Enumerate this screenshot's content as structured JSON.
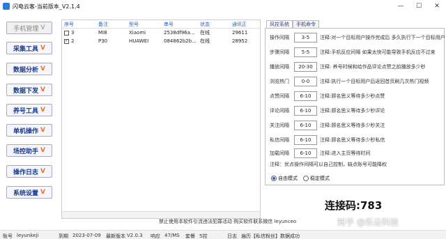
{
  "window": {
    "title": "闪电云客-当前版本_V2.1.4"
  },
  "sidebar": {
    "items": [
      {
        "label": "手机管理",
        "chevron": "V"
      },
      {
        "label": "采集工具",
        "chevron": "V"
      },
      {
        "label": "数据分析",
        "chevron": "V"
      },
      {
        "label": "数据下发",
        "chevron": "V"
      },
      {
        "label": "养号工具",
        "chevron": "V"
      },
      {
        "label": "单机操作",
        "chevron": "V"
      },
      {
        "label": "场控助手",
        "chevron": "V"
      },
      {
        "label": "操作日志",
        "chevron": "V"
      },
      {
        "label": "系统设置",
        "chevron": "V"
      }
    ]
  },
  "table": {
    "headers": [
      "序号",
      "备注",
      "型号",
      "串号",
      "状态",
      "通讯正"
    ],
    "rows": [
      {
        "checked": false,
        "index": "3",
        "remark": "MI8",
        "model": "Xiaomi",
        "serial": "2538df96a...",
        "status": "在线",
        "port": "29611"
      },
      {
        "checked": true,
        "index": "2",
        "remark": "P30",
        "model": "HUAWEI",
        "serial": "084862b2b...",
        "status": "在线",
        "port": "28952"
      }
    ]
  },
  "tabs": [
    "风控系统",
    "手机命令"
  ],
  "settings": {
    "rows": [
      {
        "label": "操作间隔",
        "value": "3-5",
        "note": "注释:对一个目标用户操作完成后 多久执行下一个目标用户"
      },
      {
        "label": "步骤间隔",
        "value": "5-5",
        "note": "注释:手机反应间隔 如果太快可能导致手机反应不过来"
      },
      {
        "label": "播放间隔",
        "value": "20-30",
        "note": "注释: 养号时候和给作品评论点赞之前播放多少秒"
      },
      {
        "label": "浏览热门",
        "value": "0-0",
        "note": "注释:执行一个目标用户后返回首页刷几次热门视频"
      },
      {
        "label": "点赞间隔",
        "value": "6-10",
        "note": "注释:顾名思义等待多少秒点赞"
      },
      {
        "label": "评论间隔",
        "value": "6-10",
        "note": "注释:顾名思义等待多少秒评论"
      },
      {
        "label": "关注间隔",
        "value": "6-10",
        "note": "注释:顾名思义等待多少秒关注"
      },
      {
        "label": "私信间隔",
        "value": "6-10",
        "note": "注释:顾名思义等待多少秒私信"
      },
      {
        "label": "加载间隔",
        "value": "6-10",
        "note": "注释:进入主页等待时间"
      }
    ],
    "warning": "注释：优点操作间隔可以自己控制，缺点账号可能降权",
    "modes": [
      {
        "label": "自由模式",
        "selected": true
      },
      {
        "label": "稳定模式",
        "selected": false
      }
    ]
  },
  "connection": {
    "text": "连接码:783"
  },
  "watermark": {
    "text": "知乎 @乐云科技"
  },
  "notice": {
    "text": "禁止使用本软件引流违法犯罪活动 购买软件联系微信 leyunceo"
  },
  "statusbar": {
    "account_label": "账号",
    "account": "leyunkeji",
    "expire_label": "到期",
    "expire": "2023-07-09",
    "latest_label": "最新版本",
    "latest": "V2.0.3",
    "response_label": "响应",
    "response": "47/MS",
    "package_label": "套餐",
    "package": "5控",
    "log_label": "日志",
    "log": "遍历【私信粉丝】数据成功"
  }
}
